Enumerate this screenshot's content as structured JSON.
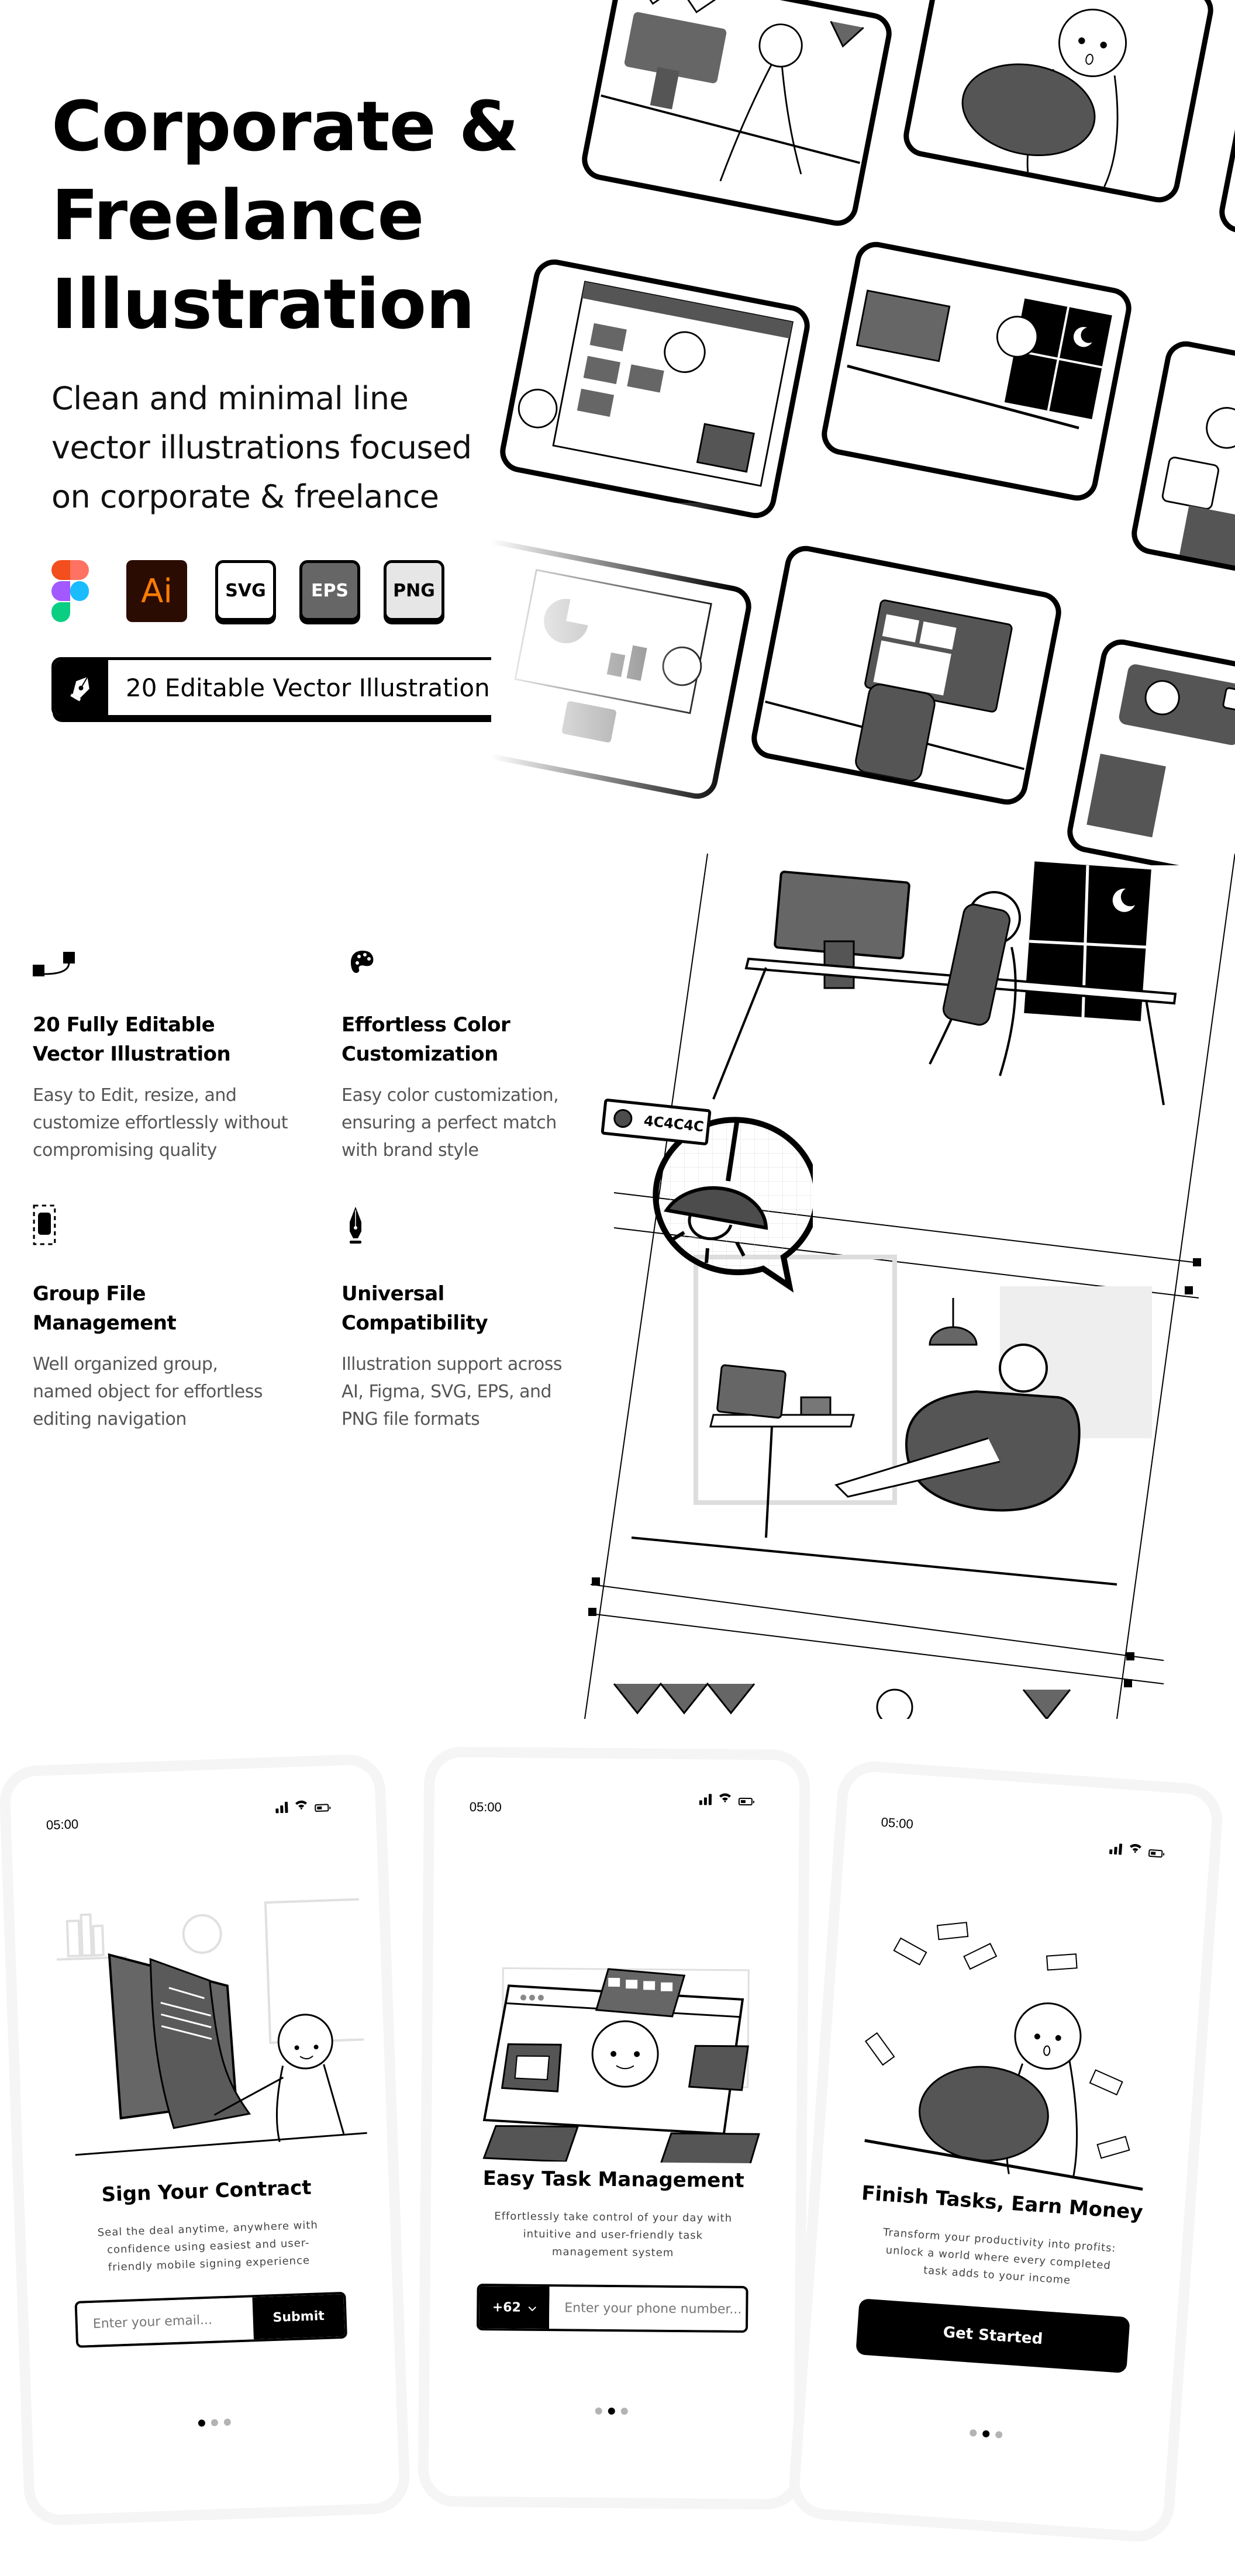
{
  "hero": {
    "title_lines": [
      "Corporate &",
      "Freelance",
      "Illustration"
    ],
    "subtitle_lines": [
      "Clean and minimal line",
      "vector illustrations focused",
      "on corporate & freelance"
    ],
    "formats": [
      {
        "id": "figma",
        "icon": "figma-logo",
        "label": ""
      },
      {
        "id": "ai",
        "icon": "adobe-illustrator-logo",
        "label": "Ai"
      },
      {
        "id": "svg",
        "icon": "svg-badge",
        "label": "SVG"
      },
      {
        "id": "eps",
        "icon": "eps-badge",
        "label": "EPS"
      },
      {
        "id": "png",
        "icon": "png-badge",
        "label": "PNG"
      }
    ],
    "count_banner": {
      "icon": "pen-nib-icon",
      "label": "20 Editable Vector Illustration"
    }
  },
  "features": [
    {
      "icon": "bezier-curve-icon",
      "title_lines": [
        "20 Fully Editable",
        "Vector Illustration"
      ],
      "desc_lines": [
        "Easy to Edit, resize, and",
        "customize effortlessly without",
        "compromising quality"
      ]
    },
    {
      "icon": "palette-icon",
      "title_lines": [
        "Effortless Color",
        "Customization"
      ],
      "desc_lines": [
        "Easy color customization,",
        "ensuring a perfect match",
        "with brand style"
      ]
    },
    {
      "icon": "group-selection-icon",
      "title_lines": [
        "Group File",
        "Management"
      ],
      "desc_lines": [
        "Well organized group,",
        "named object for effortless",
        "editing navigation"
      ]
    },
    {
      "icon": "fountain-pen-icon",
      "title_lines": [
        "Universal",
        "Compatibility"
      ],
      "desc_lines": [
        "Illustration support across",
        "AI, Figma, SVG, EPS, and",
        "PNG file formats"
      ]
    }
  ],
  "artboard": {
    "color_chip": {
      "label": "4C4C4C",
      "swatch": "#4C4C4C"
    }
  },
  "colors": {
    "accent": "#4C4C4C",
    "ink": "#000000",
    "muted": "#555555",
    "dot_inactive": "#B3B3B3"
  },
  "phones": [
    {
      "time": "05:00",
      "title": "Sign Your Contract",
      "desc_lines": [
        "Seal the deal anytime, anywhere with",
        "confidence using easiest and user-",
        "friendly mobile signing experience"
      ],
      "input_placeholder": "Enter your email...",
      "button_label": "Submit",
      "pagination": {
        "total": 3,
        "active": 1
      }
    },
    {
      "time": "05:00",
      "title": "Easy Task Management",
      "desc_lines": [
        "Effortlessly take control of your day with",
        "intuitive and user-friendly task",
        "management system"
      ],
      "country_code": "+62",
      "input_placeholder": "Enter your phone number...",
      "pagination": {
        "total": 3,
        "active": 2
      }
    },
    {
      "time": "05:00",
      "title": "Finish Tasks, Earn Money",
      "desc_lines": [
        "Transform your productivity into profits:",
        "unlock a world where every completed",
        "task adds to your income"
      ],
      "button_label": "Get Started",
      "pagination": {
        "total": 3,
        "active": 2
      }
    }
  ]
}
